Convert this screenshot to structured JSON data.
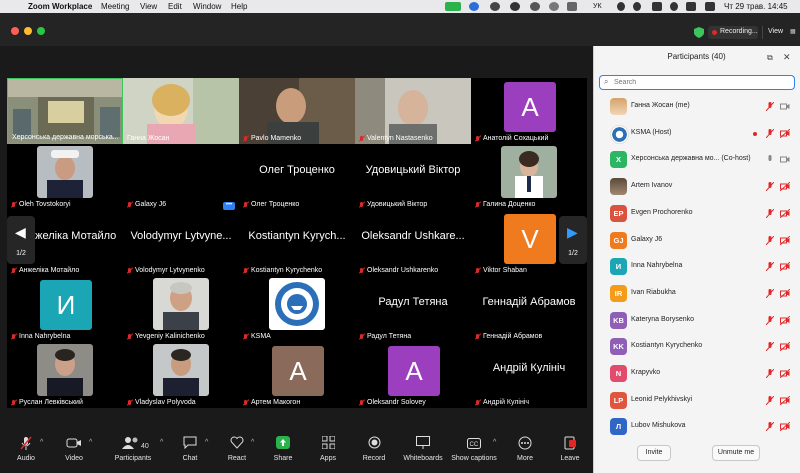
{
  "menubar": {
    "app": "Zoom Workplace",
    "items": [
      "Meeting",
      "View",
      "Edit",
      "Window",
      "Help"
    ],
    "keyboard_layout": "УК",
    "clock": "Чт 29 трав.  14:45"
  },
  "titlebar": {
    "recording_label": "Recording...",
    "view_label": "View"
  },
  "gallery": {
    "page_indicator_left": "1/2",
    "page_indicator_right": "1/2",
    "tiles": [
      {
        "name": "Херсонська державна морська..."
      },
      {
        "name": "Ганна Жосан"
      },
      {
        "name": "Pavlo Mamenko"
      },
      {
        "name": "Valentyn Nastasenko"
      },
      {
        "name": "Анатолій Сохацький",
        "avatar": "A"
      },
      {
        "name": "Oleh Tovstokoryi"
      },
      {
        "name": "Galaxy J6"
      },
      {
        "name": "Олег Троценко",
        "big": "Олег Троценко"
      },
      {
        "name": "Удовицький Віктор",
        "big": "Удовицький Віктор"
      },
      {
        "name": "Галина Доценко"
      },
      {
        "name": "Анжеліка Мотайло",
        "big": "Анжеліка Мотайло"
      },
      {
        "name": "Volodymyr Lytvynenko",
        "big": "Volodymyr Lytvyne..."
      },
      {
        "name": "Kostiantyn Kyrychenko",
        "big": "Kostiantyn Kyrych..."
      },
      {
        "name": "Oleksandr Ushkarenko",
        "big": "Oleksandr Ushkare..."
      },
      {
        "name": "Viktor Shaban",
        "avatar": "V"
      },
      {
        "name": "Inna Nahrybelna",
        "avatar": "И"
      },
      {
        "name": "Yevgeniy Kalinichenko"
      },
      {
        "name": "KSMA"
      },
      {
        "name": "Радул Тетяна",
        "big": "Радул Тетяна"
      },
      {
        "name": "Геннадій Абрамов",
        "big": "Геннадій Абрамов"
      },
      {
        "name": "Руслан Левківський"
      },
      {
        "name": "Vladyslav Polyvoda"
      },
      {
        "name": "Артем Макогон",
        "avatar": "A"
      },
      {
        "name": "Oleksandr Solovey",
        "avatar": "A"
      },
      {
        "name": "Андрій Кулініч",
        "big": "Андрій Кулініч"
      }
    ]
  },
  "toolbar": {
    "audio": "Audio",
    "video": "Video",
    "participants": "Participants",
    "participants_count": "40",
    "chat": "Chat",
    "react": "React",
    "share": "Share",
    "apps": "Apps",
    "record": "Record",
    "whiteboards": "Whiteboards",
    "captions": "Show captions",
    "more": "More",
    "leave": "Leave"
  },
  "panel": {
    "title": "Participants (40)",
    "search_placeholder": "Search",
    "invite": "Invite",
    "unmute_me": "Unmute me",
    "participants": [
      {
        "name": "Ганна Жосан (me)",
        "avatar": "",
        "color": "#e8b887"
      },
      {
        "name": "KSMA (Host)",
        "avatar": "",
        "color": "#3b78c4"
      },
      {
        "name": "Херсонська державна мо...  (Co-host)",
        "avatar": "X",
        "color": "#2db563"
      },
      {
        "name": "Artem Ivanov",
        "avatar": "",
        "color": "#7c6a58"
      },
      {
        "name": "Evgen Prochorenko",
        "avatar": "EP",
        "color": "#d9533e"
      },
      {
        "name": "Galaxy J6",
        "avatar": "GJ",
        "color": "#f07b1f"
      },
      {
        "name": "Inna Nahrybelna",
        "avatar": "И",
        "color": "#1ba6b5"
      },
      {
        "name": "Ivan Riabukha",
        "avatar": "IR",
        "color": "#f59b1a"
      },
      {
        "name": "Kateryna Borysenko",
        "avatar": "KB",
        "color": "#8e5fb5"
      },
      {
        "name": "Kostiantyn Kyrychenko",
        "avatar": "KK",
        "color": "#8e5fb5"
      },
      {
        "name": "Krapyvko",
        "avatar": "N",
        "color": "#e34b6c"
      },
      {
        "name": "Leonid Pelykhivskyi",
        "avatar": "LP",
        "color": "#e0553d"
      },
      {
        "name": "Lubov Mishukova",
        "avatar": "Л",
        "color": "#2f67c7"
      }
    ]
  },
  "colors": {
    "accent_blue": "#2f7ff5",
    "mute_red": "#e02828",
    "active_speaker_green": "#3ec45c"
  }
}
